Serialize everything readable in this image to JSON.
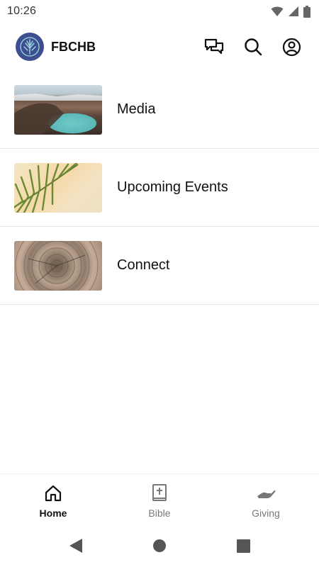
{
  "status_bar": {
    "time": "10:26",
    "icons": [
      "wifi-icon",
      "signal-icon",
      "battery-icon"
    ]
  },
  "header": {
    "title": "FBCHB",
    "logo": "tree-logo",
    "actions": [
      "chat-icon",
      "search-icon",
      "account-icon"
    ]
  },
  "list": {
    "items": [
      {
        "label": "Media",
        "thumbnail": "volcanic crater lake"
      },
      {
        "label": "Upcoming Events",
        "thumbnail": "palm leaf"
      },
      {
        "label": "Connect",
        "thumbnail": "tree rings"
      }
    ]
  },
  "bottom_nav": {
    "items": [
      {
        "label": "Home",
        "icon": "home-icon",
        "active": true
      },
      {
        "label": "Bible",
        "icon": "bible-icon",
        "active": false
      },
      {
        "label": "Giving",
        "icon": "giving-hand-icon",
        "active": false
      }
    ]
  },
  "colors": {
    "logo_bg": "#3d4f8f",
    "active_nav": "#111111",
    "inactive_nav": "#777777",
    "divider": "#e6e6e6"
  }
}
